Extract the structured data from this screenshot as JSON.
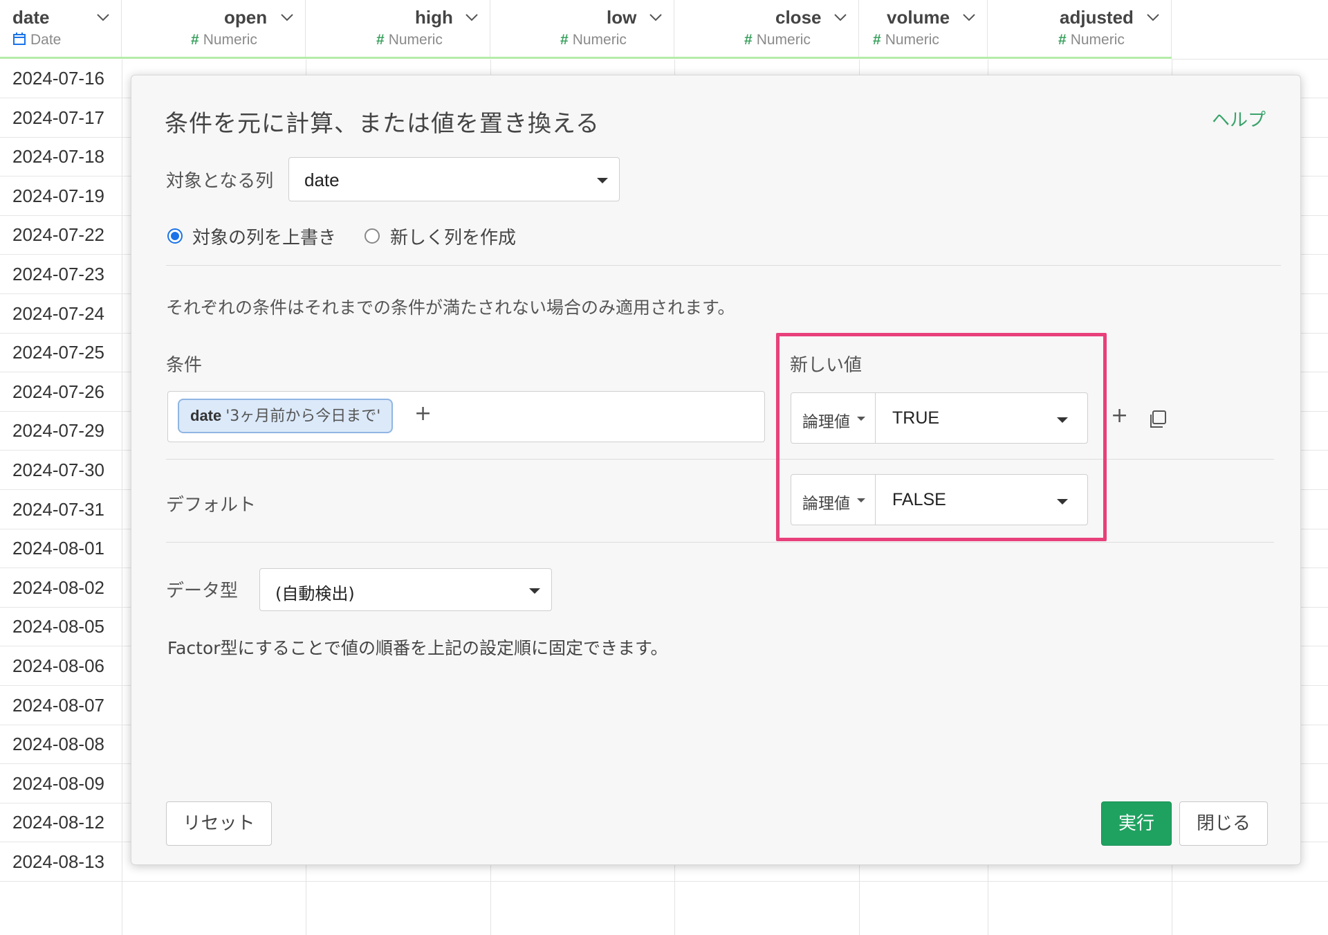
{
  "grid": {
    "columns": [
      {
        "name": "date",
        "type": "Date",
        "type_icon": "calendar-icon"
      },
      {
        "name": "open",
        "type": "Numeric",
        "type_icon": "hash-icon"
      },
      {
        "name": "high",
        "type": "Numeric",
        "type_icon": "hash-icon"
      },
      {
        "name": "low",
        "type": "Numeric",
        "type_icon": "hash-icon"
      },
      {
        "name": "close",
        "type": "Numeric",
        "type_icon": "hash-icon"
      },
      {
        "name": "volume",
        "type": "Numeric",
        "type_icon": "hash-icon"
      },
      {
        "name": "adjusted",
        "type": "Numeric",
        "type_icon": "hash-icon"
      }
    ],
    "rows": [
      "2024-07-16",
      "2024-07-17",
      "2024-07-18",
      "2024-07-19",
      "2024-07-22",
      "2024-07-23",
      "2024-07-24",
      "2024-07-25",
      "2024-07-26",
      "2024-07-29",
      "2024-07-30",
      "2024-07-31",
      "2024-08-01",
      "2024-08-02",
      "2024-08-05",
      "2024-08-06",
      "2024-08-07",
      "2024-08-08",
      "2024-08-09",
      "2024-08-12",
      "2024-08-13"
    ]
  },
  "dialog": {
    "title": "条件を元に計算、または値を置き換える",
    "help_label": "ヘルプ",
    "target_column_label": "対象となる列",
    "target_column_value": "date",
    "radio_overwrite_label": "対象の列を上書き",
    "radio_new_label": "新しく列を作成",
    "radio_selected": "overwrite",
    "note": "それぞれの条件はそれまでの条件が満たされない場合のみ適用されます。",
    "condition_header": "条件",
    "new_value_header": "新しい値",
    "condition_chip_column": "date",
    "condition_chip_text": "'3ヶ月前から今日まで'",
    "add_condition_label": "+",
    "value_type_label": "論理値",
    "condition_value": "TRUE",
    "default_label": "デフォルト",
    "default_type_label": "論理値",
    "default_value": "FALSE",
    "add_row_label": "+",
    "datatype_label": "データ型",
    "datatype_value": "(自動検出)",
    "factor_note": "Factor型にすることで値の順番を上記の設定順に固定できます。",
    "reset_label": "リセット",
    "run_label": "実行",
    "close_label": "閉じる"
  },
  "colors": {
    "accent_green": "#1fa260",
    "highlight_pink": "#e8407a",
    "radio_blue": "#1a73e8",
    "header_bar_green": "#b4eca8"
  }
}
